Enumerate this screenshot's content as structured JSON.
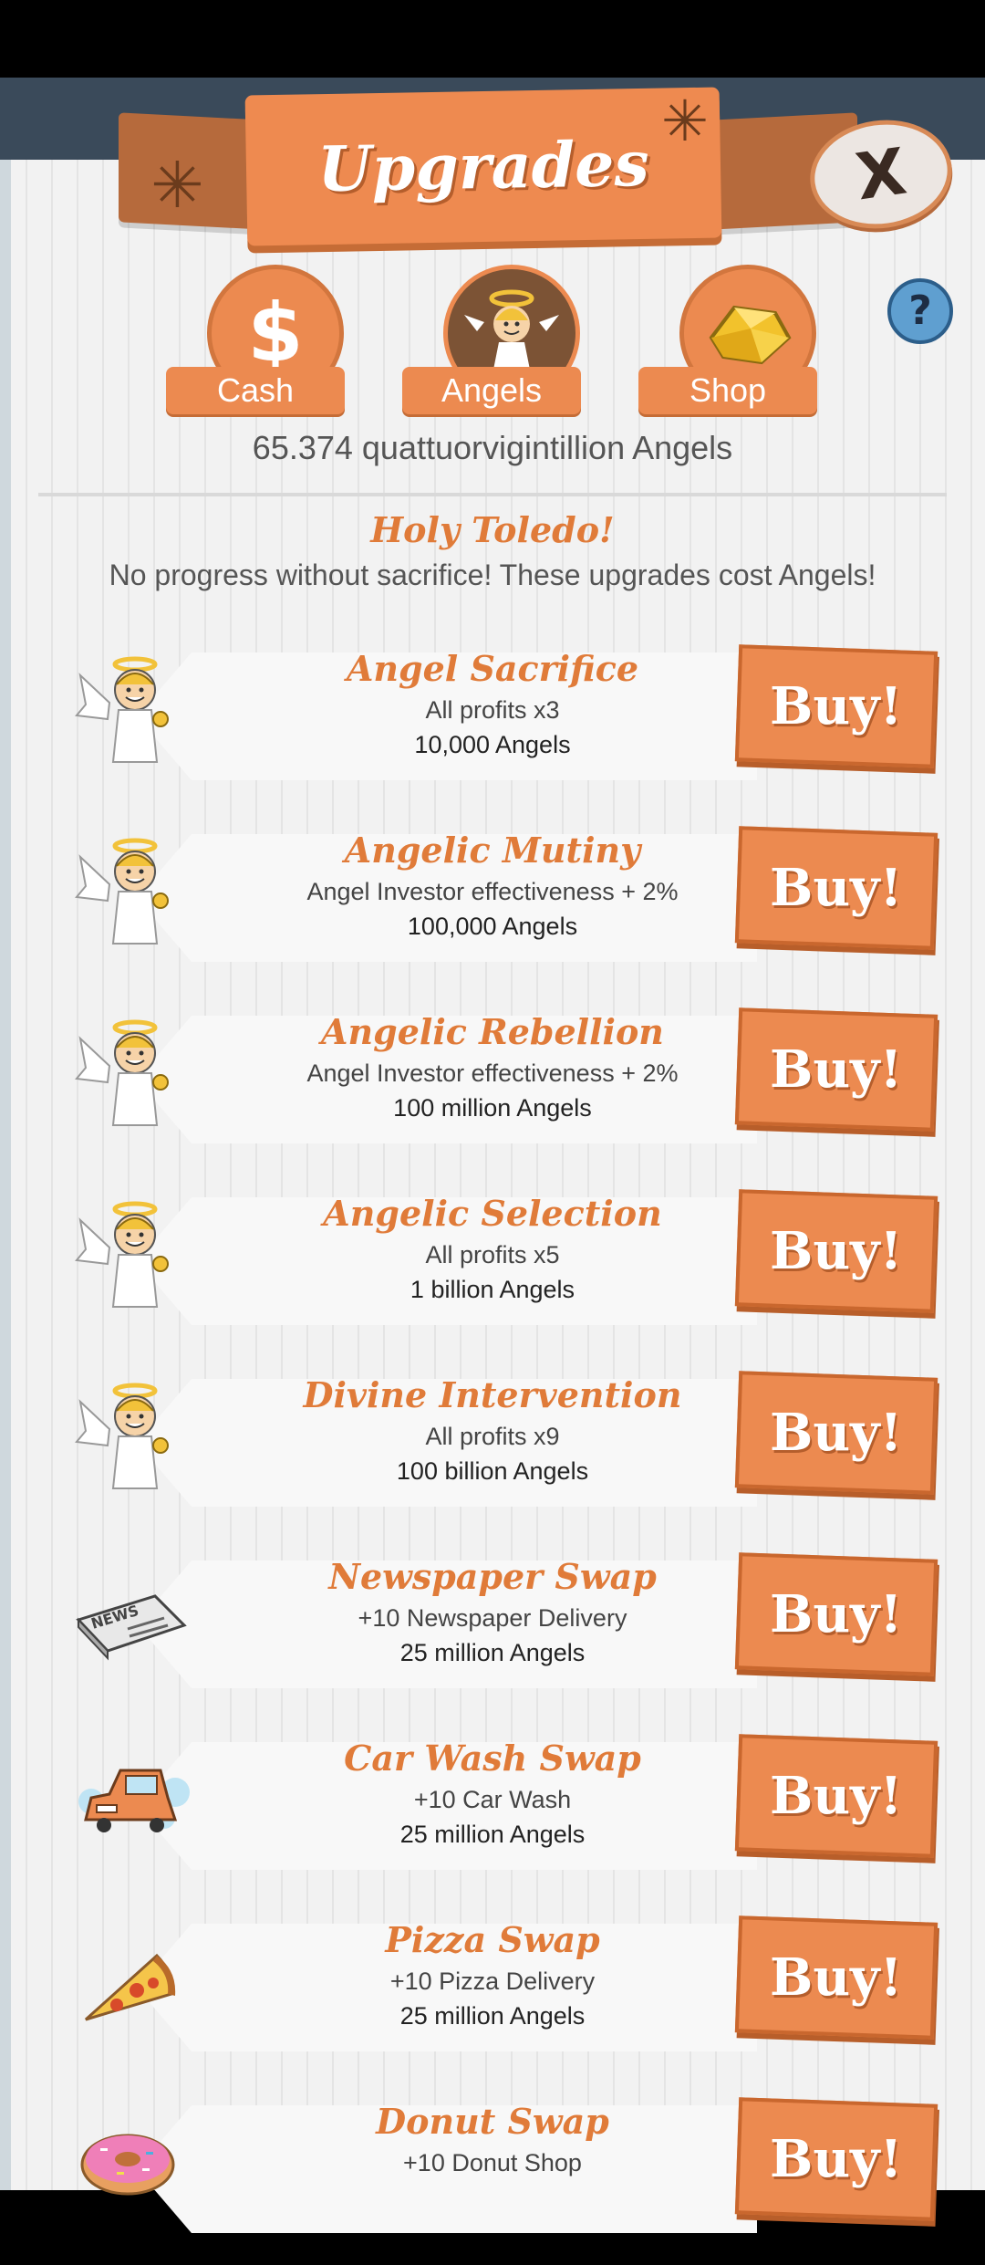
{
  "header": {
    "title": "Upgrades",
    "close_label": "X"
  },
  "tabs": [
    {
      "label": "Cash",
      "icon": "dollar-icon"
    },
    {
      "label": "Angels",
      "icon": "angel-icon",
      "selected": true
    },
    {
      "label": "Shop",
      "icon": "gold-icon"
    }
  ],
  "help_label": "?",
  "angel_count": "65.374 quattuorvigintillion Angels",
  "section": {
    "title": "Holy Toledo!",
    "subtitle": "No progress without sacrifice! These upgrades cost Angels!"
  },
  "buy_label": "Buy!",
  "upgrades": [
    {
      "name": "Angel Sacrifice",
      "desc": "All profits x3",
      "cost": "10,000 Angels",
      "icon": "angel-icon"
    },
    {
      "name": "Angelic Mutiny",
      "desc": "Angel Investor effectiveness + 2%",
      "cost": "100,000 Angels",
      "icon": "angel-icon"
    },
    {
      "name": "Angelic Rebellion",
      "desc": "Angel Investor effectiveness + 2%",
      "cost": "100 million Angels",
      "icon": "angel-icon"
    },
    {
      "name": "Angelic Selection",
      "desc": "All profits x5",
      "cost": "1 billion Angels",
      "icon": "angel-icon"
    },
    {
      "name": "Divine Intervention",
      "desc": "All profits x9",
      "cost": "100 billion Angels",
      "icon": "angel-icon"
    },
    {
      "name": "Newspaper Swap",
      "desc": "+10 Newspaper Delivery",
      "cost": "25 million Angels",
      "icon": "newspaper-icon"
    },
    {
      "name": "Car Wash Swap",
      "desc": "+10 Car Wash",
      "cost": "25 million Angels",
      "icon": "car-icon"
    },
    {
      "name": "Pizza Swap",
      "desc": "+10 Pizza Delivery",
      "cost": "25 million Angels",
      "icon": "pizza-icon"
    },
    {
      "name": "Donut Swap",
      "desc": "+10 Donut Shop",
      "cost": "",
      "icon": "donut-icon"
    }
  ],
  "colors": {
    "accent": "#ec8a50",
    "title_orange": "#e07b39",
    "header_brown": "#b66a3c"
  }
}
